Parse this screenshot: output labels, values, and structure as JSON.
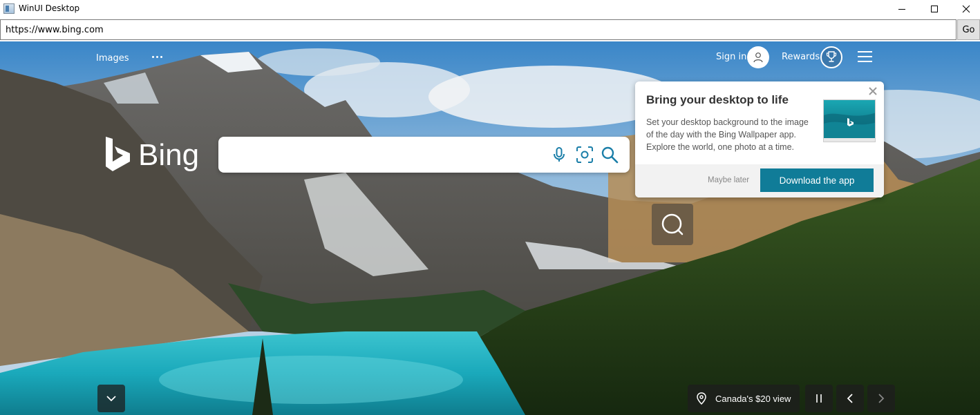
{
  "window": {
    "title": "WinUI Desktop"
  },
  "address_bar": {
    "url": "https://www.bing.com",
    "go_label": "Go"
  },
  "bing": {
    "nav": {
      "images_label": "Images"
    },
    "header": {
      "signin_label": "Sign in",
      "rewards_label": "Rewards"
    },
    "logo_text": "Bing",
    "search": {
      "value": ""
    },
    "popup": {
      "title": "Bring your desktop to life",
      "body": "Set your desktop background to the image of the day with the Bing Wallpaper app. Explore the world, one photo at a time.",
      "maybe_later_label": "Maybe later",
      "download_label": "Download the app"
    },
    "image_info": {
      "location_label": "Canada's $20 view"
    }
  },
  "colors": {
    "accent": "#107c98",
    "search_icon": "#1a7ea8"
  },
  "icons": [
    "app-icon",
    "minimize-icon",
    "maximize-icon",
    "close-icon",
    "more-icon",
    "user-icon",
    "trophy-icon",
    "hamburger-icon",
    "microphone-icon",
    "visual-search-icon",
    "search-icon",
    "chevron-down-icon",
    "location-pin-icon",
    "pause-icon",
    "chevron-left-icon",
    "chevron-right-icon"
  ]
}
